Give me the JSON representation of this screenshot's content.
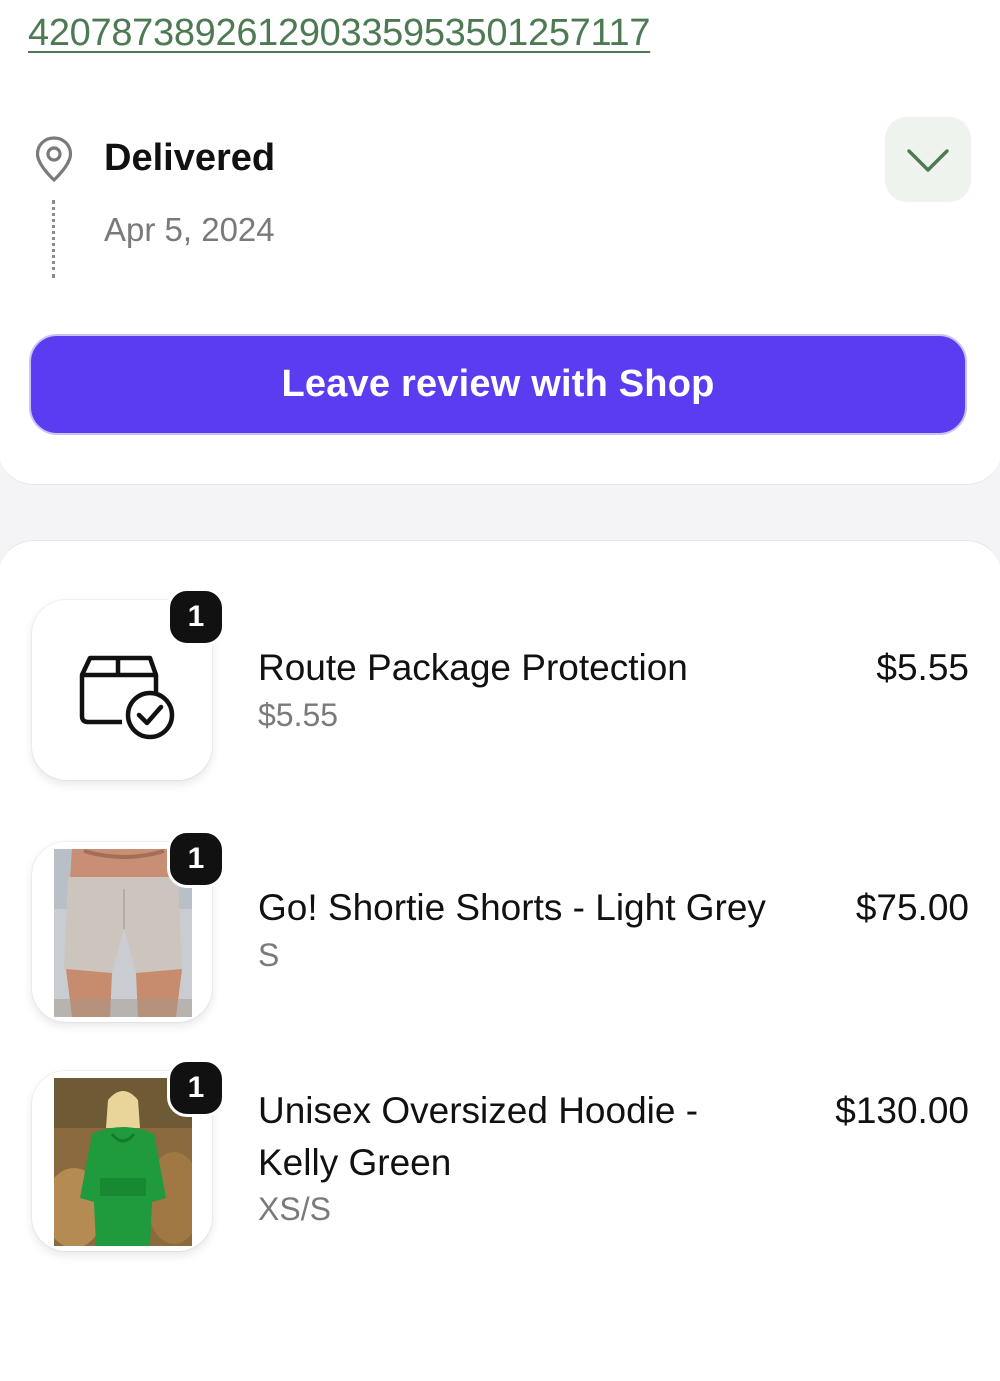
{
  "tracking": {
    "number": "420787389261290335953501257117"
  },
  "shipment": {
    "status": "Delivered",
    "date": "Apr 5, 2024"
  },
  "actions": {
    "review_label": "Leave review with Shop"
  },
  "colors": {
    "accent": "#5b3cf0",
    "tracking_link": "#4d7a53",
    "expand_bg": "#eef3ee"
  },
  "items": [
    {
      "name": "Route Package Protection",
      "subtitle": "$5.55",
      "price": "$5.55",
      "quantity": "1",
      "thumbnail": "package-protection-icon"
    },
    {
      "name": "Go! Shortie Shorts - Light Grey",
      "subtitle": "S",
      "price": "$75.00",
      "quantity": "1",
      "thumbnail": "shorts-photo"
    },
    {
      "name": "Unisex Oversized Hoodie - Kelly Green",
      "subtitle": "XS/S",
      "price": "$130.00",
      "quantity": "1",
      "thumbnail": "hoodie-photo"
    }
  ]
}
